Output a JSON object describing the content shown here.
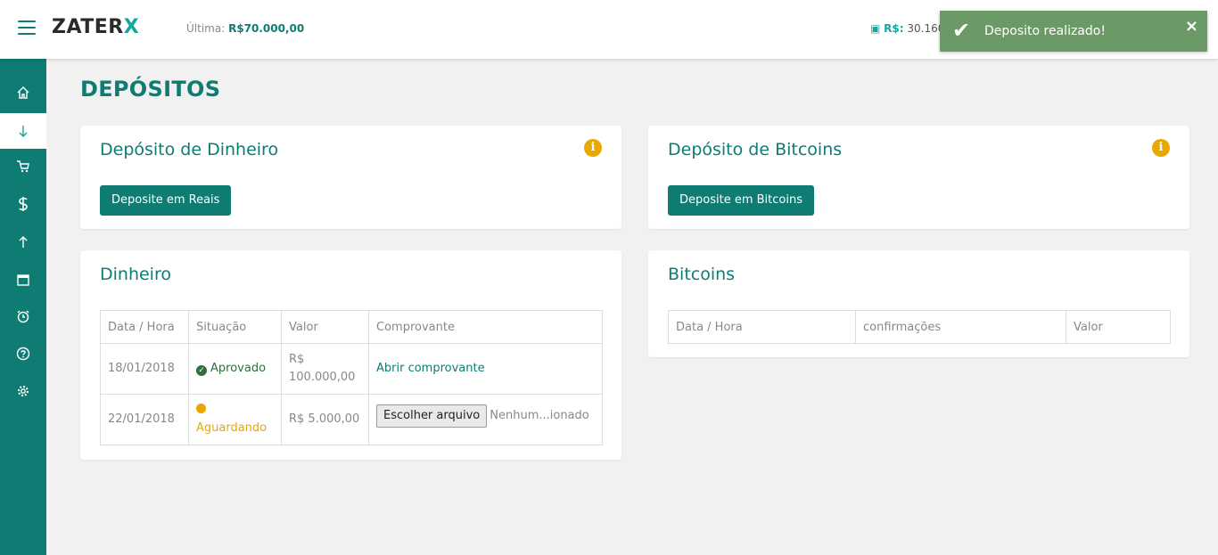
{
  "brand": {
    "name_main": "ZATER",
    "name_x": "X"
  },
  "header": {
    "last_label": "Última:",
    "last_value": "R$70.000,00",
    "balance_label": "R$:",
    "balance_value": "30.160,"
  },
  "toast": {
    "message": "Deposito realizado!",
    "close": "×",
    "check": "✔"
  },
  "sidebar": {
    "items": [
      {
        "icon": "home-icon",
        "glyph": "⌂"
      },
      {
        "icon": "download-arrow-icon",
        "glyph": "↓"
      },
      {
        "icon": "cart-icon",
        "glyph": "🛒"
      },
      {
        "icon": "dollar-icon",
        "glyph": "$"
      },
      {
        "icon": "upload-arrow-icon",
        "glyph": "↑"
      },
      {
        "icon": "calendar-icon",
        "glyph": "▬"
      },
      {
        "icon": "alarm-clock-icon",
        "glyph": "⏰"
      },
      {
        "icon": "help-icon",
        "glyph": "?"
      },
      {
        "icon": "settings-gear-icon",
        "glyph": "⚙"
      }
    ]
  },
  "page": {
    "title": "DEPÓSITOS"
  },
  "cash_deposit": {
    "title": "Depósito de Dinheiro",
    "button": "Deposite em Reais",
    "info": "i"
  },
  "btc_deposit": {
    "title": "Depósito de Bitcoins",
    "button": "Deposite em Bitcoins",
    "info": "i"
  },
  "cash_table": {
    "title": "Dinheiro",
    "headers": [
      "Data / Hora",
      "Situação",
      "Valor",
      "Comprovante"
    ],
    "rows": [
      {
        "date": "18/01/2018",
        "status": "Aprovado",
        "value": "R$ 100.000,00",
        "receipt": "Abrir comprovante"
      },
      {
        "date": "22/01/2018",
        "status": "Aguardando",
        "value": "R$ 5.000,00",
        "file_button": "Escolher arquivo",
        "file_label": "Nenhum...ionado"
      }
    ]
  },
  "btc_table": {
    "title": "Bitcoins",
    "headers": [
      "Data / Hora",
      "confirmações",
      "Valor"
    ]
  }
}
